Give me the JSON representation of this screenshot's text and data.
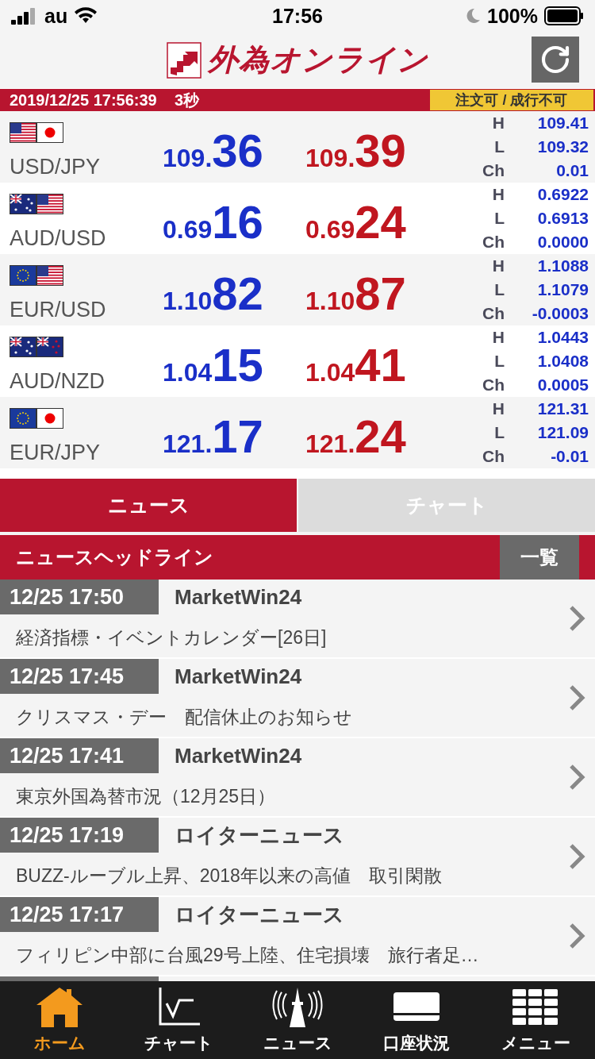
{
  "status_bar": {
    "carrier": "au",
    "time": "17:56",
    "battery": "100%"
  },
  "header": {
    "logo_text": "外為オンライン"
  },
  "info_bar": {
    "timestamp": "2019/12/25 17:56:39",
    "interval": "3秒",
    "order_status": "注文可 / 成行不可"
  },
  "rates": [
    {
      "pair": "USD/JPY",
      "flags": [
        {
          "kind": "us"
        },
        {
          "kind": "jp"
        }
      ],
      "bid": {
        "prefix": "109.",
        "pips": "36"
      },
      "ask": {
        "prefix": "109.",
        "pips": "39"
      },
      "high_label": "H",
      "high": "109.41",
      "low_label": "L",
      "low": "109.32",
      "change_label": "Ch",
      "change": "0.01"
    },
    {
      "pair": "AUD/USD",
      "flags": [
        {
          "kind": "au"
        },
        {
          "kind": "us"
        }
      ],
      "bid": {
        "prefix": "0.69",
        "pips": "16"
      },
      "ask": {
        "prefix": "0.69",
        "pips": "24"
      },
      "high_label": "H",
      "high": "0.6922",
      "low_label": "L",
      "low": "0.6913",
      "change_label": "Ch",
      "change": "0.0000"
    },
    {
      "pair": "EUR/USD",
      "flags": [
        {
          "kind": "eu"
        },
        {
          "kind": "us"
        }
      ],
      "bid": {
        "prefix": "1.10",
        "pips": "82"
      },
      "ask": {
        "prefix": "1.10",
        "pips": "87"
      },
      "high_label": "H",
      "high": "1.1088",
      "low_label": "L",
      "low": "1.1079",
      "change_label": "Ch",
      "change": "-0.0003"
    },
    {
      "pair": "AUD/NZD",
      "flags": [
        {
          "kind": "au"
        },
        {
          "kind": "nz"
        }
      ],
      "bid": {
        "prefix": "1.04",
        "pips": "15"
      },
      "ask": {
        "prefix": "1.04",
        "pips": "41"
      },
      "high_label": "H",
      "high": "1.0443",
      "low_label": "L",
      "low": "1.0408",
      "change_label": "Ch",
      "change": "0.0005"
    },
    {
      "pair": "EUR/JPY",
      "flags": [
        {
          "kind": "eu"
        },
        {
          "kind": "jp"
        }
      ],
      "bid": {
        "prefix": "121.",
        "pips": "17"
      },
      "ask": {
        "prefix": "121.",
        "pips": "24"
      },
      "high_label": "H",
      "high": "121.31",
      "low_label": "L",
      "low": "121.09",
      "change_label": "Ch",
      "change": "-0.01"
    }
  ],
  "tabs": [
    {
      "label": "ニュース",
      "selected": true
    },
    {
      "label": "チャート",
      "selected": false
    }
  ],
  "news": {
    "title": "ニュースヘッドライン",
    "list_button": "一覧",
    "items": [
      {
        "time": "12/25 17:50",
        "source": "MarketWin24",
        "headline": "経済指標・イベントカレンダー[26日]"
      },
      {
        "time": "12/25 17:45",
        "source": "MarketWin24",
        "headline": "クリスマス・デー　配信休止のお知らせ"
      },
      {
        "time": "12/25 17:41",
        "source": "MarketWin24",
        "headline": "東京外国為替市況（12月25日）"
      },
      {
        "time": "12/25 17:19",
        "source": "ロイターニュース",
        "headline": "BUZZ-ルーブル上昇、2018年以来の高値　取引閑散"
      },
      {
        "time": "12/25 17:17",
        "source": "ロイターニュース",
        "headline": "フィリピン中部に台風29号上陸、住宅損壊　旅行者足…"
      }
    ]
  },
  "bottom_nav": [
    {
      "kind": "home",
      "label": "ホーム",
      "selected": true
    },
    {
      "kind": "chart",
      "label": "チャート",
      "selected": false
    },
    {
      "kind": "news",
      "label": "ニュース",
      "selected": false
    },
    {
      "kind": "account",
      "label": "口座状況",
      "selected": false
    },
    {
      "kind": "menu",
      "label": "メニュー",
      "selected": false
    }
  ]
}
